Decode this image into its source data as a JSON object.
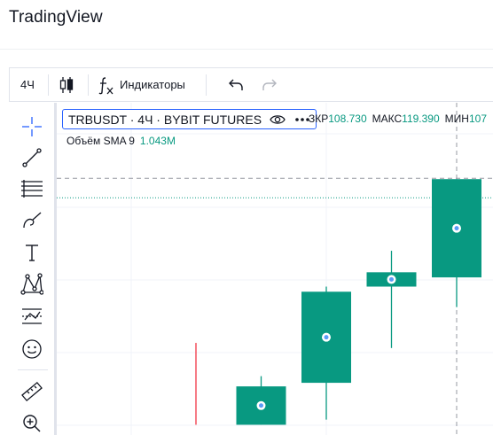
{
  "app": {
    "title": "TradingView"
  },
  "toolbar": {
    "interval": "4Ч",
    "indicators_label": "Индикаторы",
    "chart_type_icon": "candles-icon",
    "undo_icon": "undo-icon",
    "redo_icon": "redo-icon"
  },
  "drawing_tools": [
    "crosshair-icon",
    "trend-line-icon",
    "fib-levels-icon",
    "brush-icon",
    "text-icon",
    "pattern-icon",
    "prediction-icon",
    "emoji-icon",
    "ruler-icon",
    "zoom-in-icon"
  ],
  "legend": {
    "symbol": "TRBUSDT · 4Ч · BYBIT FUTURES",
    "ohlc": [
      {
        "label": "ЗКР",
        "value": "108.730"
      },
      {
        "label": "МАКС",
        "value": "119.390"
      },
      {
        "label": "МИН",
        "value": "107"
      }
    ],
    "volume_label": "Объём SMA 9",
    "volume_value": "1.043M"
  },
  "colors": {
    "up_candle": "#089981",
    "down_wick": "#f23645",
    "accent": "#2962ff",
    "grid": "#f0f3fa"
  },
  "candles": [
    {
      "open": 78.5,
      "close": 78.5,
      "high": 88.0,
      "low": 72.0,
      "direction": "down"
    },
    {
      "open": 72.0,
      "close": 79.5,
      "high": 81.5,
      "low": 72.0,
      "direction": "up"
    },
    {
      "open": 80.2,
      "close": 98.0,
      "high": 99.0,
      "low": 73.0,
      "direction": "up"
    },
    {
      "open": 99.0,
      "close": 101.8,
      "high": 106.0,
      "low": 87.0,
      "direction": "up"
    },
    {
      "open": 100.8,
      "close": 120.0,
      "high": 120.0,
      "low": 95.0,
      "direction": "up"
    }
  ]
}
